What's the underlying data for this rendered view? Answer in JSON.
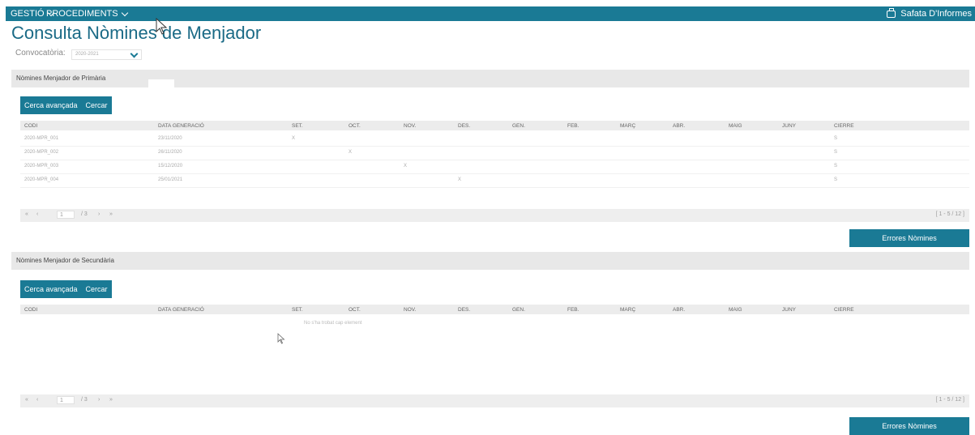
{
  "topbar": {
    "menu_gestio": "GESTIÓ",
    "menu_procediments": "PROCEDIMENTS",
    "print_label": "Safata D'Informes"
  },
  "page": {
    "title": "Consulta Nòmines de Menjador"
  },
  "convocatoria": {
    "label": "Convocatòria:",
    "value": "2020-2021"
  },
  "columns": [
    "CODI",
    "DATA GENERACIÓ",
    "SET.",
    "OCT.",
    "NOV.",
    "DES.",
    "GEN.",
    "FEB.",
    "MARÇ",
    "ABR.",
    "MAIG",
    "JUNY",
    "CIERRE"
  ],
  "primaria": {
    "section_title": "Nòmines Menjador de Primària",
    "advanced_search": "Cerca avançada",
    "search": "Cercar",
    "rows": [
      {
        "codi": "2020-MPR_001",
        "data": "23/11/2020",
        "mark": "X",
        "mark_col": 2,
        "cierre": "S"
      },
      {
        "codi": "2020-MPR_002",
        "data": "26/11/2020",
        "mark": "X",
        "mark_col": 3,
        "cierre": "S"
      },
      {
        "codi": "2020-MPR_003",
        "data": "15/12/2020",
        "mark": "X",
        "mark_col": 4,
        "cierre": "S"
      },
      {
        "codi": "2020-MPR_004",
        "data": "25/01/2021",
        "mark": "X",
        "mark_col": 5,
        "cierre": "S"
      }
    ],
    "pager": {
      "first": "«",
      "prev": "‹",
      "page": "1",
      "of": "/ 3",
      "next": "›",
      "last": "»",
      "count": "[ 1 - 5 / 12 ]"
    },
    "errors_button": "Errores Nòmines"
  },
  "secundaria": {
    "section_title": "Nòmines Menjador de Secundària",
    "advanced_search": "Cerca avançada",
    "search": "Cercar",
    "empty_text": "No s'ha trobat cap element",
    "pager": {
      "first": "«",
      "prev": "‹",
      "page": "1",
      "of": "/ 3",
      "next": "›",
      "last": "»",
      "count": "[ 1 - 5 / 12 ]"
    },
    "errors_button": "Errores Nòmines"
  },
  "colors": {
    "accent": "#1a7a95",
    "title": "#1a6a86"
  },
  "icons": {
    "print": "printer-icon",
    "menu": "chevron-down-icon",
    "select": "chevron-down-icon"
  }
}
